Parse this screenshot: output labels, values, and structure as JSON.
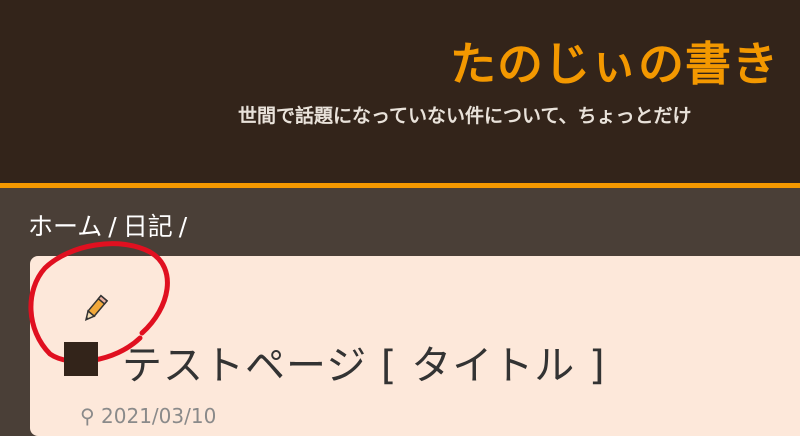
{
  "header": {
    "site_title": "たのじぃの書き",
    "site_description": "世間で話題になっていない件について、ちょっとだけ"
  },
  "breadcrumb": {
    "items": [
      "ホーム",
      "日記"
    ],
    "separator": "/"
  },
  "content": {
    "edit_icon": "pencil-icon",
    "page_title": "テストページ [ タイトル ]",
    "date": "2021/03/10"
  },
  "colors": {
    "header_bg": "#33241a",
    "accent": "#f39800",
    "page_bg": "#4a3f37",
    "card_bg": "#fde8da",
    "annotation": "#e01020"
  }
}
